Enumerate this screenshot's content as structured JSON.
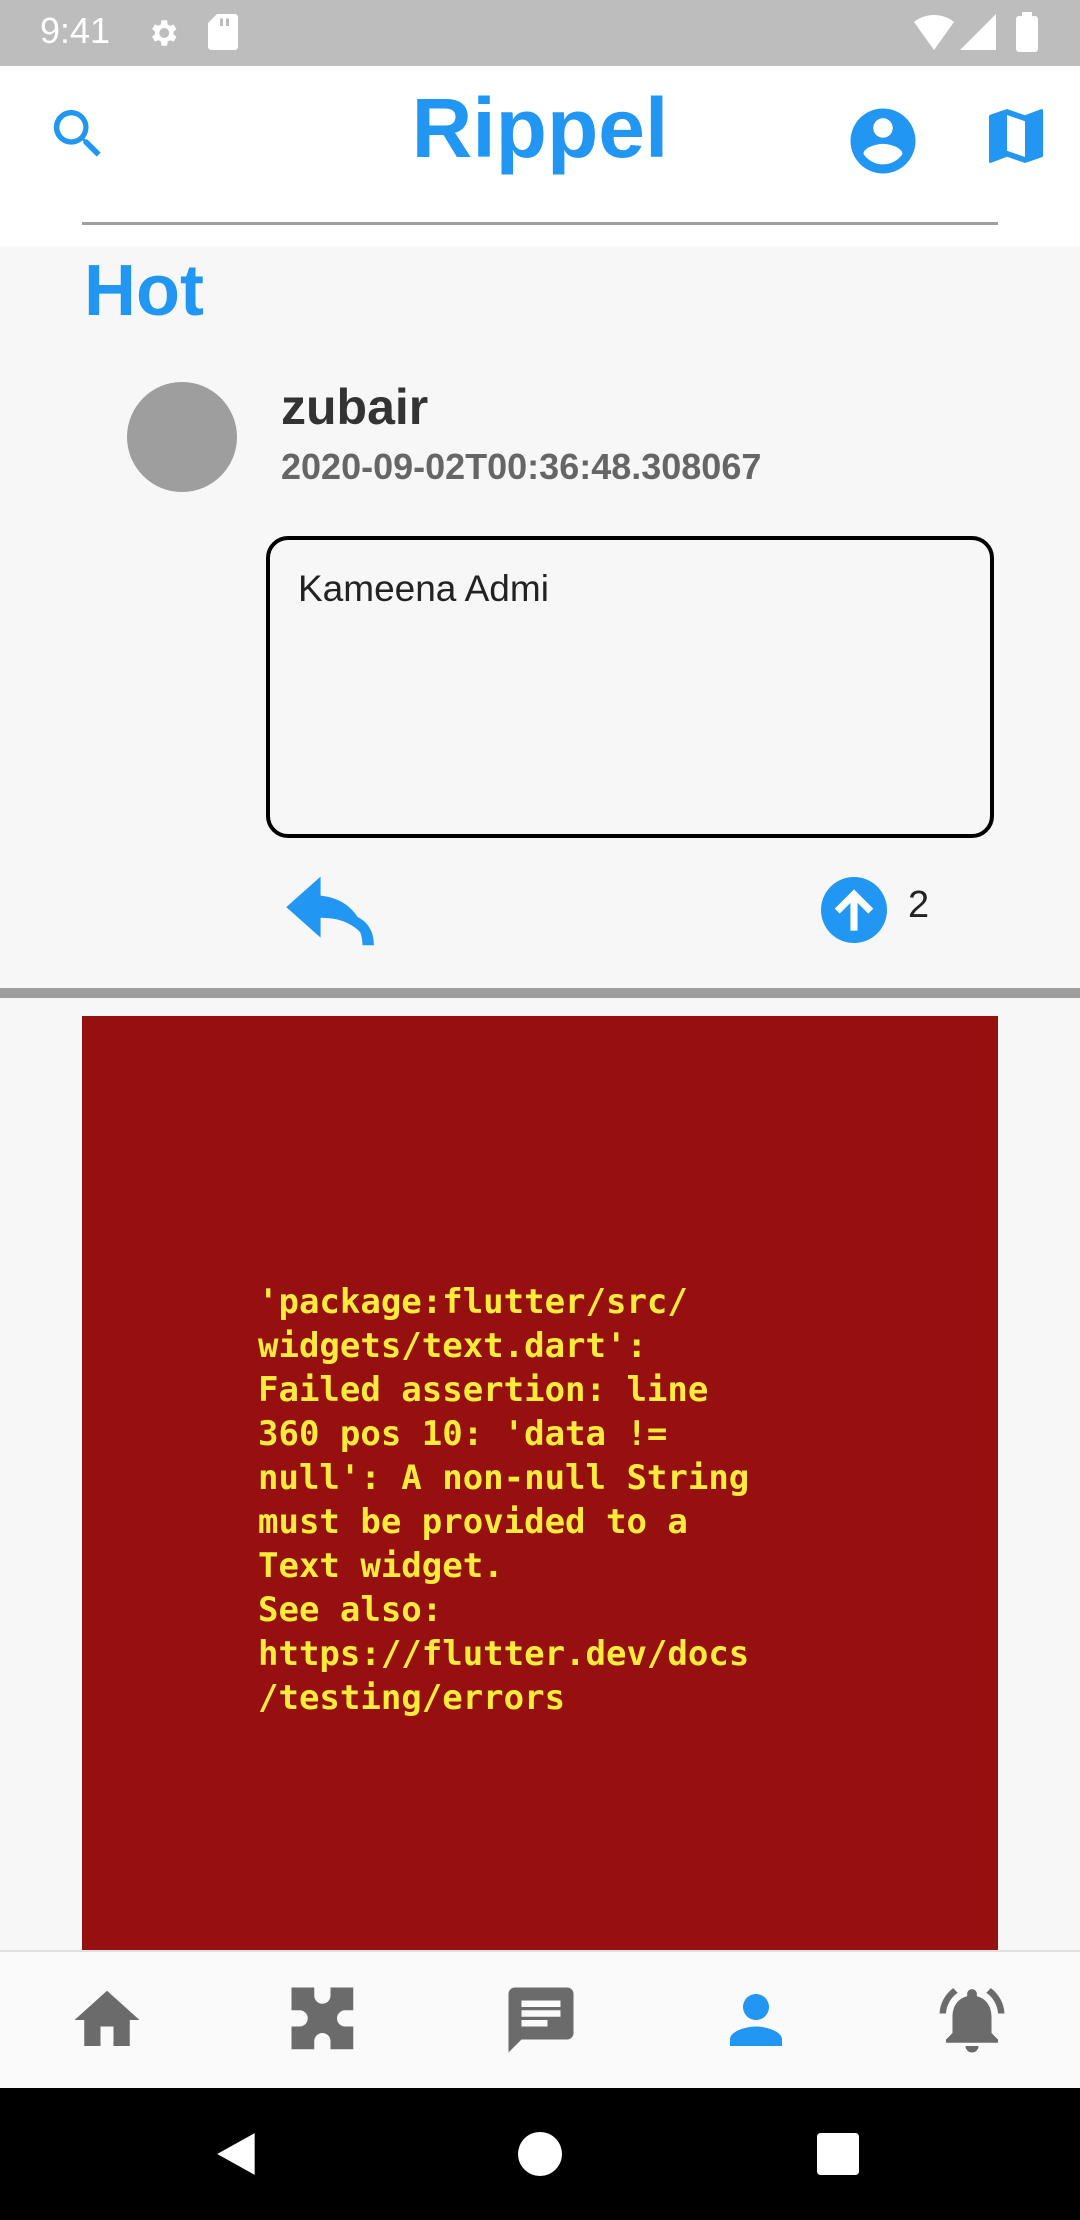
{
  "status_bar": {
    "time": "9:41"
  },
  "app_bar": {
    "title": "Rippel"
  },
  "feed": {
    "section_title": "Hot",
    "post": {
      "username": "zubair",
      "timestamp": "2020-09-02T00:36:48.308067",
      "body": "Kameena Admi",
      "upvotes": "2"
    },
    "error_message": "'package:flutter/src/\nwidgets/text.dart':\nFailed assertion: line\n360 pos 10: 'data !=\nnull': A non-null String\nmust be provided to a\nText widget.\nSee also:\nhttps://flutter.dev/docs\n/testing/errors"
  },
  "bottom_nav": {
    "items": [
      {
        "icon": "home-icon"
      },
      {
        "icon": "puzzle-icon"
      },
      {
        "icon": "chat-icon"
      },
      {
        "icon": "person-icon",
        "active": true
      },
      {
        "icon": "bell-icon"
      }
    ]
  },
  "colors": {
    "accent": "#2196f3",
    "inactive": "#6b6b6b",
    "error_bg": "#961010",
    "error_text": "#ffeb3b"
  }
}
